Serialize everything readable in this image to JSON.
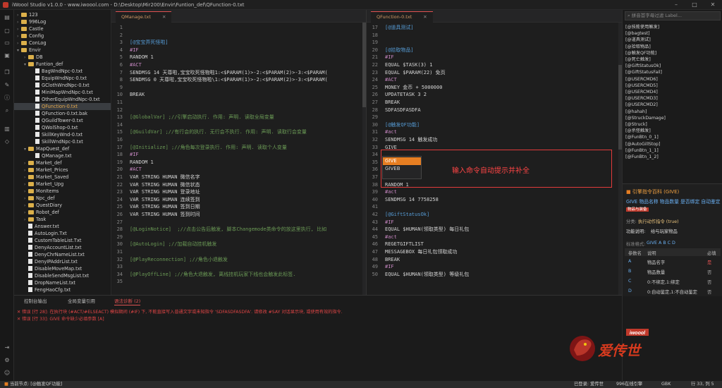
{
  "window": {
    "title": "iWoool Studio v1.0.0 - www.iwoool.com - D:\\Desktop\\Mir200\\Envir\\Funtion_def\\QFunction-0.txt"
  },
  "explorer": {
    "items": [
      {
        "label": "123",
        "kind": "folder",
        "depth": 0
      },
      {
        "label": "996Log",
        "kind": "folder",
        "depth": 0
      },
      {
        "label": "Castle",
        "kind": "folder",
        "depth": 0
      },
      {
        "label": "Config",
        "kind": "folder",
        "depth": 0
      },
      {
        "label": "ConLog",
        "kind": "folder",
        "depth": 0
      },
      {
        "label": "Envir",
        "kind": "folder",
        "depth": 0,
        "open": true
      },
      {
        "label": "DB",
        "kind": "folder",
        "depth": 1
      },
      {
        "label": "Funtion_def",
        "kind": "folder",
        "depth": 1,
        "open": true
      },
      {
        "label": "BagWndNpc-0.txt",
        "kind": "file",
        "depth": 2
      },
      {
        "label": "EquipWndNpc-0.txt",
        "kind": "file",
        "depth": 2
      },
      {
        "label": "GClothWndNpc-0.txt",
        "kind": "file",
        "depth": 2
      },
      {
        "label": "MiniMapWndNpc-0.txt",
        "kind": "file",
        "depth": 2
      },
      {
        "label": "OtherEquipWndNpc-0.txt",
        "kind": "file",
        "depth": 2
      },
      {
        "label": "QFunction-0.txt",
        "kind": "file",
        "depth": 2,
        "selected": true
      },
      {
        "label": "QFunction-0.txt.bak",
        "kind": "file",
        "depth": 2
      },
      {
        "label": "QGuildTower-0.txt",
        "kind": "file",
        "depth": 2
      },
      {
        "label": "QWolShop-0.txt",
        "kind": "file",
        "depth": 2
      },
      {
        "label": "SkillKeyWnd-0.txt",
        "kind": "file",
        "depth": 2
      },
      {
        "label": "SkillWndNpc-0.txt",
        "kind": "file",
        "depth": 2
      },
      {
        "label": "MapQuest_def",
        "kind": "folder",
        "depth": 1,
        "open": true
      },
      {
        "label": "QManage.txt",
        "kind": "file",
        "depth": 2
      },
      {
        "label": "Market_def",
        "kind": "folder",
        "depth": 1
      },
      {
        "label": "Market_Prices",
        "kind": "folder",
        "depth": 1
      },
      {
        "label": "Market_Saved",
        "kind": "folder",
        "depth": 1
      },
      {
        "label": "Market_Upg",
        "kind": "folder",
        "depth": 1
      },
      {
        "label": "MonItems",
        "kind": "folder",
        "depth": 1
      },
      {
        "label": "Npc_def",
        "kind": "folder",
        "depth": 1
      },
      {
        "label": "QuestDiary",
        "kind": "folder",
        "depth": 1
      },
      {
        "label": "Robot_def",
        "kind": "folder",
        "depth": 1
      },
      {
        "label": "Task",
        "kind": "folder",
        "depth": 1
      },
      {
        "label": "Answer.txt",
        "kind": "file",
        "depth": 1
      },
      {
        "label": "AutoLogin.Txt",
        "kind": "file",
        "depth": 1
      },
      {
        "label": "CustomTableList.Txt",
        "kind": "file",
        "depth": 1
      },
      {
        "label": "DenyAccountList.txt",
        "kind": "file",
        "depth": 1
      },
      {
        "label": "DenyChrNameList.txt",
        "kind": "file",
        "depth": 1
      },
      {
        "label": "DenyIPAddrList.txt",
        "kind": "file",
        "depth": 1
      },
      {
        "label": "DisableMoveMap.txt",
        "kind": "file",
        "depth": 1
      },
      {
        "label": "DisableSendMsgList.txt",
        "kind": "file",
        "depth": 1
      },
      {
        "label": "DropNameList.txt",
        "kind": "file",
        "depth": 1
      },
      {
        "label": "FengHaoCfg.txt",
        "kind": "file",
        "depth": 1
      }
    ]
  },
  "editor_left": {
    "tab": "QManage.txt",
    "lines": [
      {
        "n": "1",
        "t": ""
      },
      {
        "n": "2",
        "t": ""
      },
      {
        "n": "3",
        "t": "[@宝宝弄死怪啦]",
        "c": "sec"
      },
      {
        "n": "4",
        "t": "#IF",
        "c": "key"
      },
      {
        "n": "5",
        "t": "RANDOM 1"
      },
      {
        "n": "6",
        "t": "#ACT",
        "c": "key"
      },
      {
        "n": "7",
        "t": "SENDMSG 14 天尊啦,宝宝吹死怪物啦1:<$PARAM(1)>-2:<$PARAM(2)>-3:<$PARAM("
      },
      {
        "n": "8",
        "t": "SENDMSG 0 天尊啦,宝宝吹死怪物啦\\1:<$PARAM(1)>-2:<$PARAM(2)>-3:<$PARAM("
      },
      {
        "n": "9",
        "t": ""
      },
      {
        "n": "10",
        "t": "BREAK"
      },
      {
        "n": "11",
        "t": ""
      },
      {
        "n": "12",
        "t": ""
      },
      {
        "n": "13",
        "t": "[@GlobalVar] ;//引擎启动执行. 作用: 声明. 读取全局变量",
        "c": "seccmt"
      },
      {
        "n": "14",
        "t": ""
      },
      {
        "n": "15",
        "t": "[@GuildVar] ;//有行会的执行. 无行会不执行. 作用: 声明. 读取行会变量",
        "c": "seccmt"
      },
      {
        "n": "16",
        "t": ""
      },
      {
        "n": "17",
        "t": "[@Initialize] ;//角色每次登录执行. 作用: 声明. 读取个人变量",
        "c": "seccmt"
      },
      {
        "n": "18",
        "t": "#IF",
        "c": "key"
      },
      {
        "n": "19",
        "t": "RANDOM 1"
      },
      {
        "n": "20",
        "t": "#ACT",
        "c": "key"
      },
      {
        "n": "21",
        "t": "VAR STRING HUMAN 微信名字"
      },
      {
        "n": "22",
        "t": "VAR STRING HUMAN 微信状态"
      },
      {
        "n": "23",
        "t": "VAR STRING HUMAN 登录地址"
      },
      {
        "n": "24",
        "t": "VAR STRING HUMAN 连续签到"
      },
      {
        "n": "25",
        "t": "VAR STRING HUMAN 签到日期"
      },
      {
        "n": "26",
        "t": "VAR STRING HUMAN 签到时间"
      },
      {
        "n": "27",
        "t": ""
      },
      {
        "n": "28",
        "t": "[@LoginNotice]  ;//点击公告后触发, 脚本Changemode类命令的放这里执行, 比如",
        "c": "seccmt"
      },
      {
        "n": "29",
        "t": ""
      },
      {
        "n": "30",
        "t": "[@AutoLogin] ;//加载自动挂机触发",
        "c": "seccmt"
      },
      {
        "n": "31",
        "t": ""
      },
      {
        "n": "32",
        "t": "[@PlayReconnection] ;//角色小退触发",
        "c": "seccmt"
      },
      {
        "n": "33",
        "t": ""
      },
      {
        "n": "34",
        "t": "[@PlayOffLine] ;//角色大退触发, 离线挂机玩家下线也会触发此标签.",
        "c": "seccmt"
      },
      {
        "n": "35",
        "t": ""
      }
    ]
  },
  "editor_right": {
    "tab": "QFunction-0.txt",
    "lines": [
      {
        "n": "17",
        "t": "[@道具测试]",
        "c": "sec"
      },
      {
        "n": "18",
        "t": ""
      },
      {
        "n": "19",
        "t": ""
      },
      {
        "n": "20",
        "t": "[@拾取物品]",
        "c": "sec"
      },
      {
        "n": "21",
        "t": "#IF",
        "c": "key"
      },
      {
        "n": "22",
        "t": "EQUAL $TASK(3) 1"
      },
      {
        "n": "23",
        "t": "EQUAL $PARAM(22) 免页"
      },
      {
        "n": "24",
        "t": "#ACT",
        "c": "key"
      },
      {
        "n": "25",
        "t": "MONEY 金币 + 5000000"
      },
      {
        "n": "26",
        "t": "UPDATETASK 3 2"
      },
      {
        "n": "27",
        "t": "BREAK"
      },
      {
        "n": "28",
        "t": "SDFASDFASDFA"
      },
      {
        "n": "29",
        "t": ""
      },
      {
        "n": "30",
        "t": "[@触发QF功能]",
        "c": "sec"
      },
      {
        "n": "31",
        "t": "#act",
        "c": "key"
      },
      {
        "n": "32",
        "t": "SENDMSG 14 触发成功"
      },
      {
        "n": "33",
        "t": "GIVE"
      },
      {
        "n": "34",
        "t": ""
      },
      {
        "n": "35",
        "t": ""
      },
      {
        "n": "36",
        "t": "[@死亡触发]",
        "c": "sec"
      },
      {
        "n": "37",
        "t": "#IF",
        "c": "key"
      },
      {
        "n": "38",
        "t": "RANDOM 1"
      },
      {
        "n": "39",
        "t": "#act",
        "c": "key"
      },
      {
        "n": "40",
        "t": "SENDMSG 14 7758258"
      },
      {
        "n": "41",
        "t": ""
      },
      {
        "n": "42",
        "t": "[@GiftStatusOk]",
        "c": "sec"
      },
      {
        "n": "43",
        "t": "#IF",
        "c": "key"
      },
      {
        "n": "44",
        "t": "EQUAL $HUMAN(领取类型) 每日礼包"
      },
      {
        "n": "45",
        "t": "#act",
        "c": "key"
      },
      {
        "n": "46",
        "t": "REGETGIFTLIST"
      },
      {
        "n": "47",
        "t": "MESSAGEBOX 每日礼包领取成功"
      },
      {
        "n": "48",
        "t": "BREAK"
      },
      {
        "n": "49",
        "t": "#IF",
        "c": "key"
      },
      {
        "n": "50",
        "t": "EQUAL $HUMAN(领取类型) 等级礼包"
      }
    ]
  },
  "autocomplete": {
    "items": [
      "GIVE",
      "GIVEB"
    ],
    "selected": 0
  },
  "annotation": {
    "text": "输入命令自动提示并补全"
  },
  "labels_panel": {
    "search_placeholder": "拼音首字母过滤 Label...",
    "items": [
      "[@技能使用触发]",
      "[@bagtest]",
      "[@道具测试]",
      "[@拾取物品]",
      "[@触发QF功能]",
      "[@死亡触发]",
      "[@GiftStatusOk]",
      "[@GiftStatusFail]",
      "[@USERCMD6]",
      "[@USERCMD5]",
      "[@USERCMD4]",
      "[@USERCMD3]",
      "[@USERCMD2]",
      "[@hahah]",
      "[@StruckDamage]",
      "[@Struck]",
      "[@杀怪触发]",
      "[@FunBtn_0_1]",
      "[@AutoGillStop]",
      "[@FunBtn_1_1]",
      "[@FunBtn_1_2]"
    ]
  },
  "help": {
    "title": "引擎指令百科 (GIVE)",
    "syntax": "GIVE 物品名称 物品数量 是否绑定 自动鉴定",
    "badge": "物品与装备",
    "category_label": "分类:",
    "category_value": "执行动作指令 (true)",
    "desc_label": "功能说明:",
    "desc_value": "给与玩家物品",
    "format_label": "标准格式:",
    "format_value": "GIVE A B C D",
    "headers": [
      "参数名",
      "说明",
      "必填"
    ],
    "rows": [
      [
        "A",
        "物品名字",
        "是"
      ],
      [
        "B",
        "物品数量",
        "否"
      ],
      [
        "C",
        "0:不绑定,1:绑定",
        "否"
      ],
      [
        "D",
        "0:自动鉴定,1:不自动鉴定",
        "否"
      ]
    ]
  },
  "bottom": {
    "tabs": [
      "控制台输出",
      "全局变量引用",
      "语法诊断 (2)"
    ],
    "errors": [
      "错误 [行 28]: 在执行块 (#ACT/#ELSEACT) 模拟期间 (#IF) 下, 不能直接写入普通文字或未知指令 'SDFASDFASDFA'. 请修改 #SAY 对话显示块, 或使用有效的指令.",
      "错误 [行 33]: GIVE 命令缺少必填参数 [A]"
    ]
  },
  "status": {
    "left": "当前节点: [@触发QF功能]",
    "login": "已登录: 爱传世",
    "online": "996在线引擎",
    "enc": "GBK",
    "pos": "行 33, 列 5"
  },
  "watermark": {
    "brand": "爱传世",
    "site": "iwoool"
  },
  "colors": {
    "accent": "#e05252",
    "highlight": "#e67e22"
  }
}
